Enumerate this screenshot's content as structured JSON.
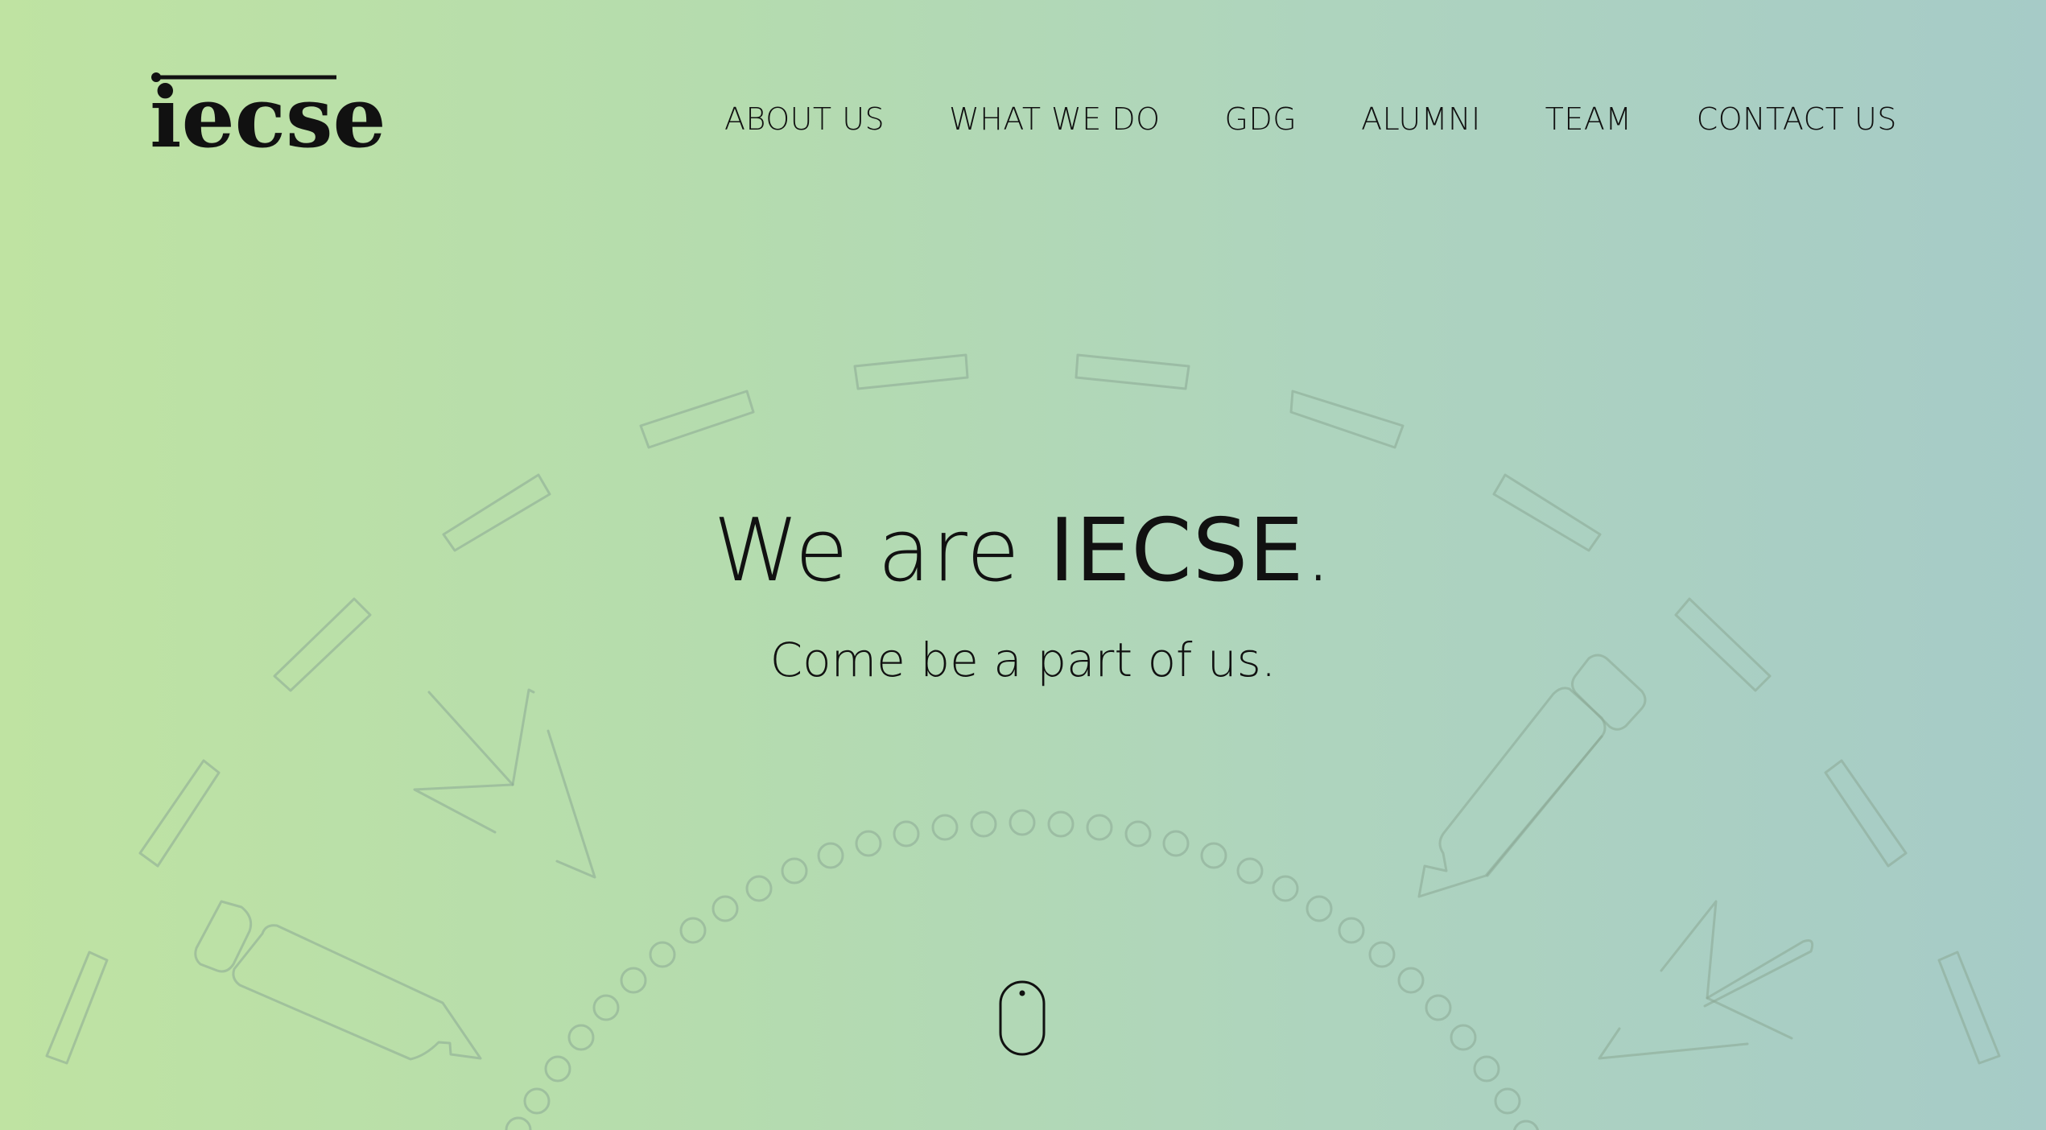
{
  "header": {
    "logo": "iecse",
    "nav": [
      {
        "label": "ABOUT US"
      },
      {
        "label": "WHAT WE DO"
      },
      {
        "label": "GDG"
      },
      {
        "label": "ALUMNI"
      },
      {
        "label": "TEAM"
      },
      {
        "label": "CONTACT US"
      }
    ]
  },
  "hero": {
    "title_prefix": "We are ",
    "title_strong": "IECSE",
    "title_suffix": ".",
    "subtitle": "Come be a part of us."
  },
  "scroll_indicator": {
    "icon": "mouse-scroll-icon"
  },
  "colors": {
    "gradient_left": "#bfe3a2",
    "gradient_right": "#a6cbc7",
    "text": "#111111",
    "decoration_stroke": "#8aa893"
  }
}
